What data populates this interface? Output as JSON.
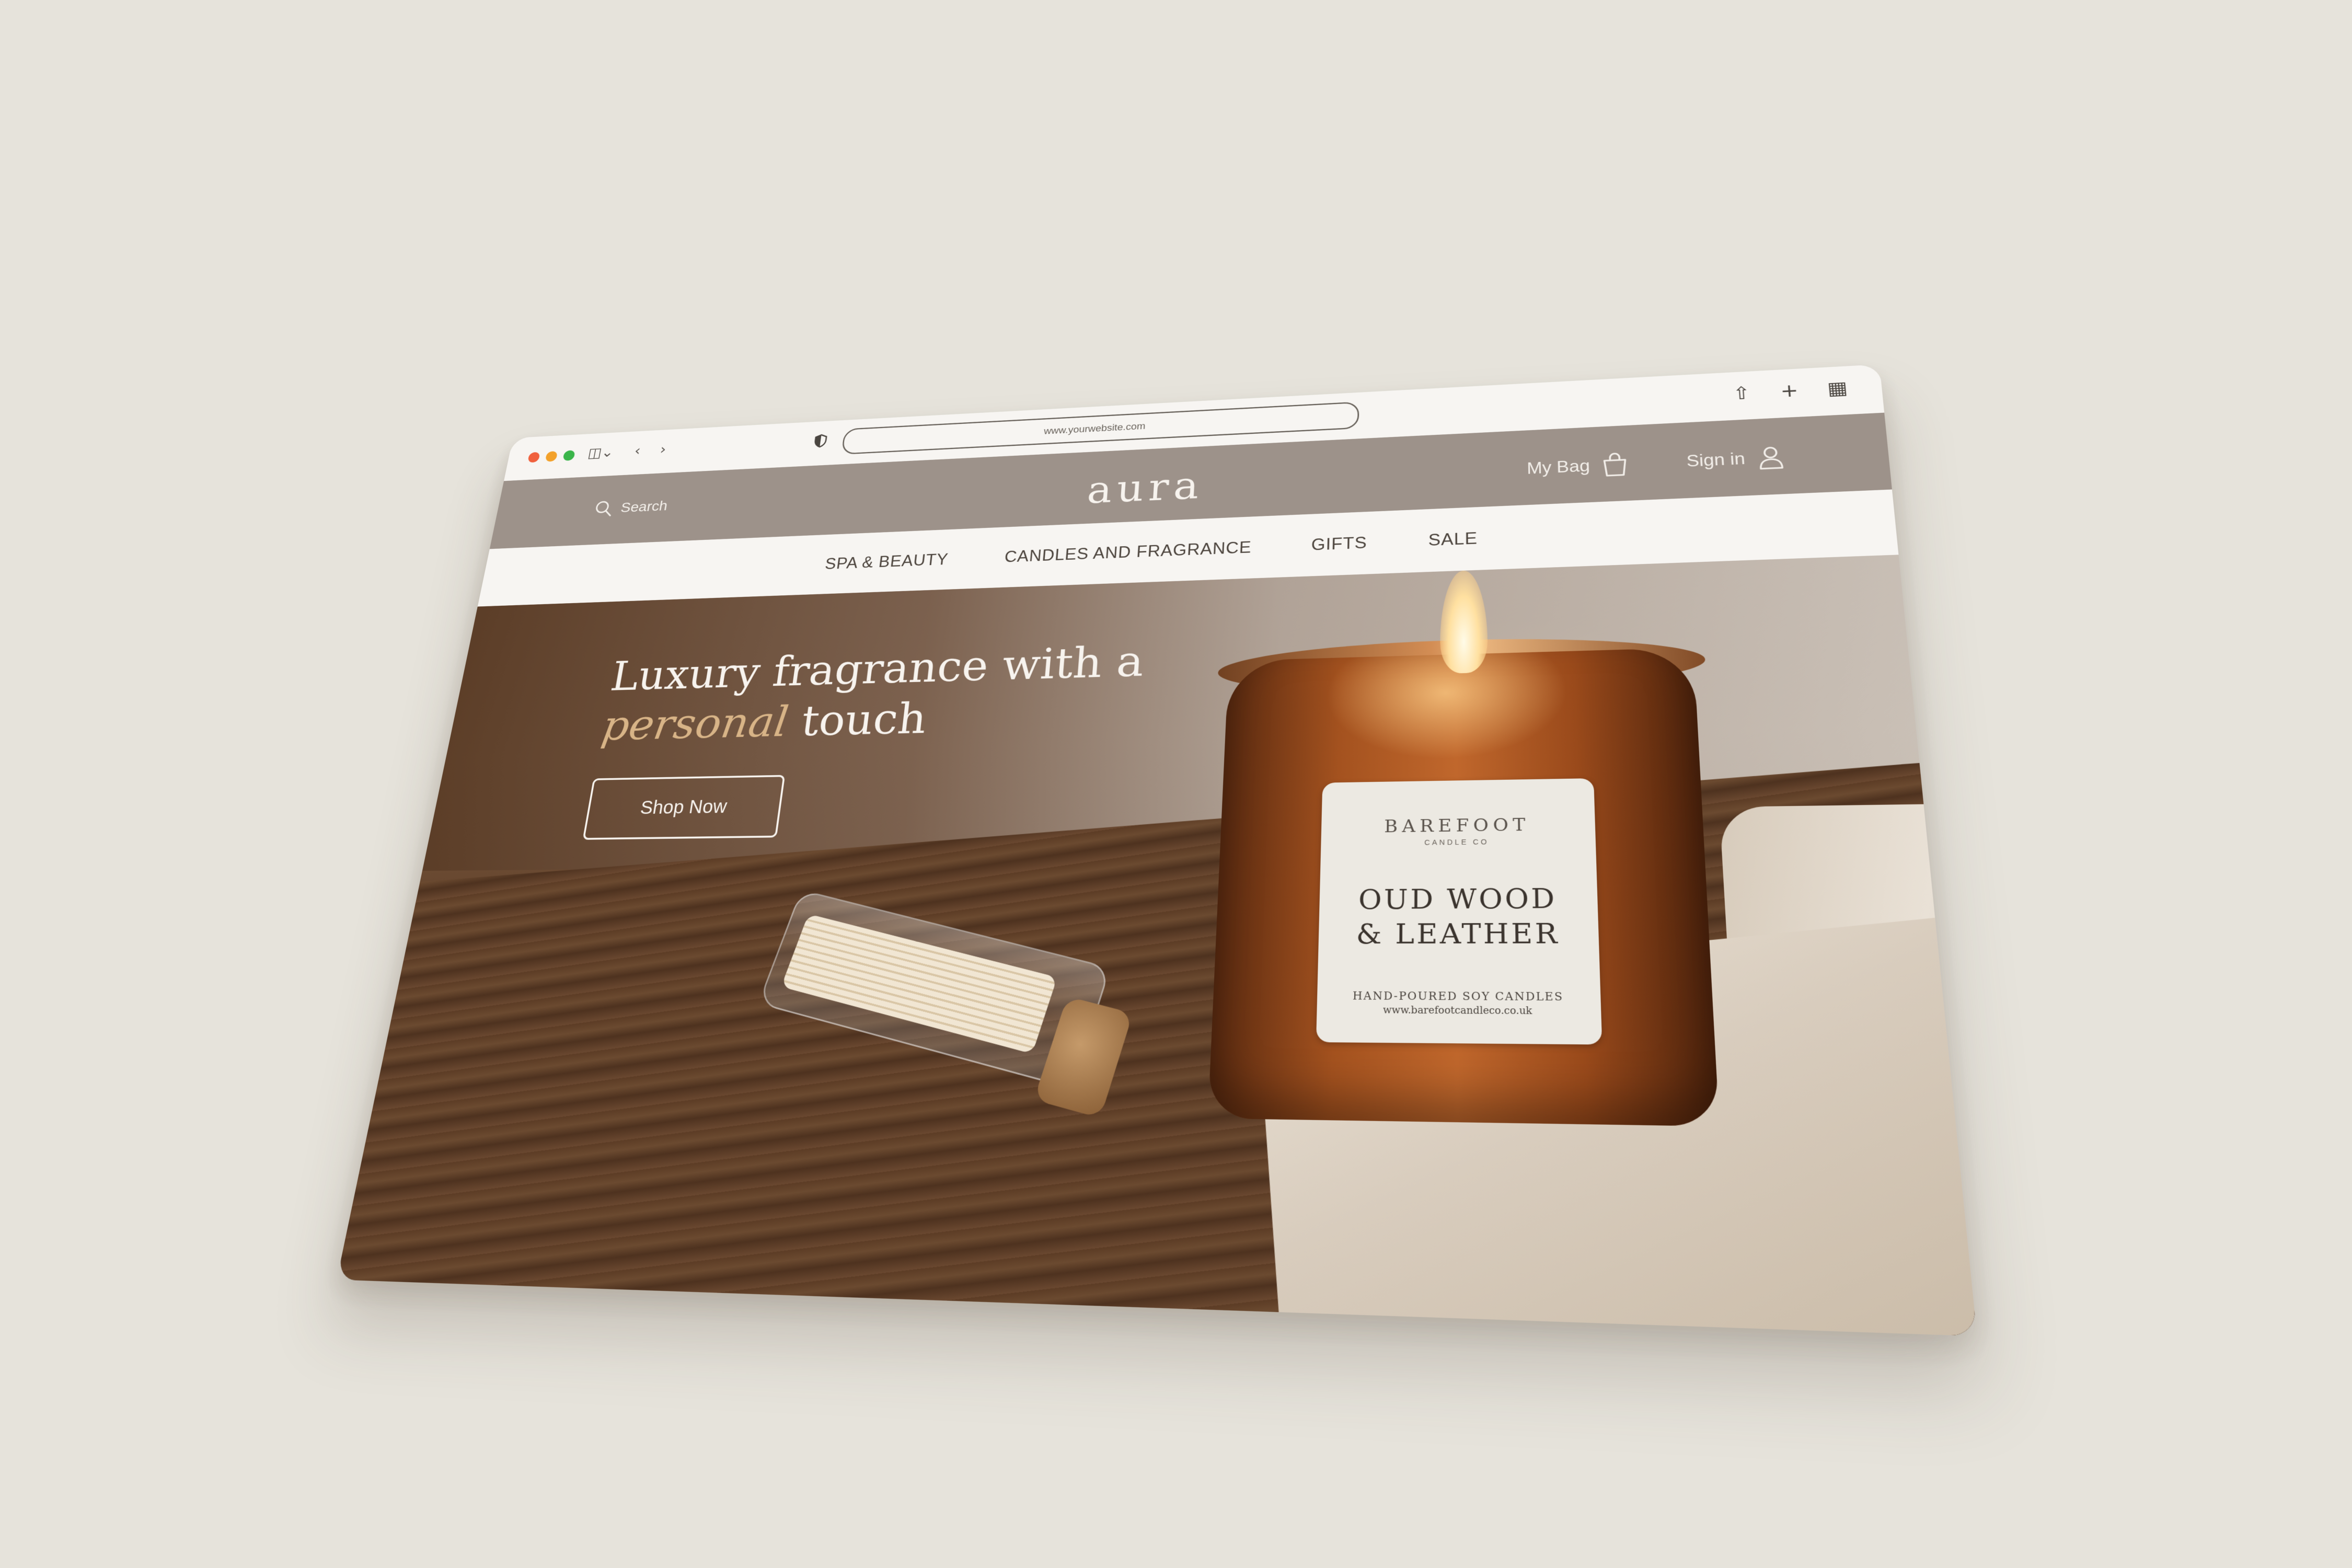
{
  "browser": {
    "url": "www.yourwebsite.com",
    "traffic_lights": [
      "#f0603d",
      "#f3a12a",
      "#3ab54a"
    ]
  },
  "header": {
    "search_label": "Search",
    "logo": "aura",
    "bag_label": "My Bag",
    "signin_label": "Sign in"
  },
  "nav": {
    "items": [
      "SPA & BEAUTY",
      "CANDLES AND FRAGRANCE",
      "GIFTS",
      "SALE"
    ]
  },
  "hero": {
    "headline_line1": "Luxury fragrance with a",
    "headline_accent": "personal",
    "headline_rest": " touch",
    "cta_label": "Shop Now"
  },
  "product_label": {
    "brand": "BAREFOOT",
    "sub": "CANDLE CO",
    "scent_line1": "OUD WOOD",
    "scent_line2": "& LEATHER",
    "tagline": "HAND-POURED SOY CANDLES",
    "url": "www.barefootcandleco.co.uk"
  },
  "colors": {
    "background": "#e6e3db",
    "header_bar": "#9d928a",
    "accent": "#d8b487"
  }
}
